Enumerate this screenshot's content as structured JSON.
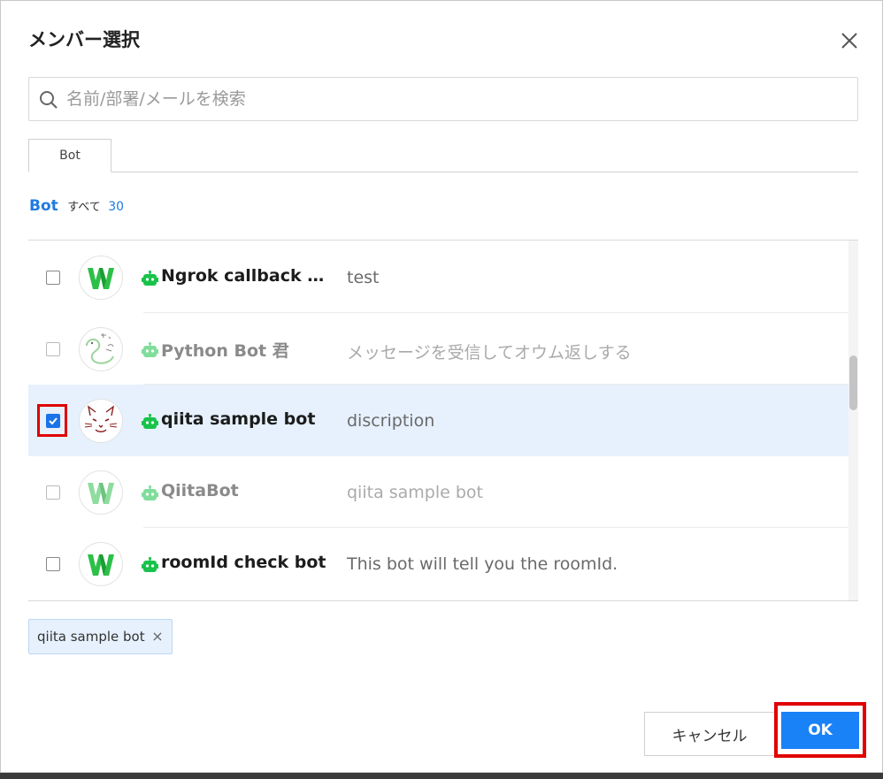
{
  "dialog": {
    "title": "メンバー選択",
    "close_icon": "close-icon"
  },
  "search": {
    "placeholder": "名前/部署/メールを検索",
    "value": ""
  },
  "tabs": [
    {
      "label": "Bot",
      "active": true
    }
  ],
  "category": {
    "name": "Bot",
    "all_label": "すべて",
    "count": "30"
  },
  "members": [
    {
      "name": "Ngrok callback …",
      "desc": "test",
      "checked": false,
      "dimmed": false,
      "avatar": "w-logo"
    },
    {
      "name": "Python Bot 君",
      "desc": "メッセージを受信してオウム返しする",
      "checked": false,
      "dimmed": true,
      "avatar": "snake-drawing"
    },
    {
      "name": "qiita sample bot",
      "desc": "discription",
      "checked": true,
      "dimmed": false,
      "avatar": "cat-face"
    },
    {
      "name": "QiitaBot",
      "desc": "qiita sample bot",
      "checked": false,
      "dimmed": true,
      "avatar": "w-logo"
    },
    {
      "name": "roomId check bot",
      "desc": "This bot will tell you the roomId.",
      "checked": false,
      "dimmed": false,
      "avatar": "w-logo"
    }
  ],
  "selected_chips": [
    {
      "label": "qiita sample bot"
    }
  ],
  "footer": {
    "cancel_label": "キャンセル",
    "ok_label": "OK"
  },
  "colors": {
    "accent": "#1a82f7",
    "link": "#1e7be0",
    "selected_row": "#e6f1fd",
    "highlight": "#e00000",
    "bot_green": "#19c34b"
  }
}
